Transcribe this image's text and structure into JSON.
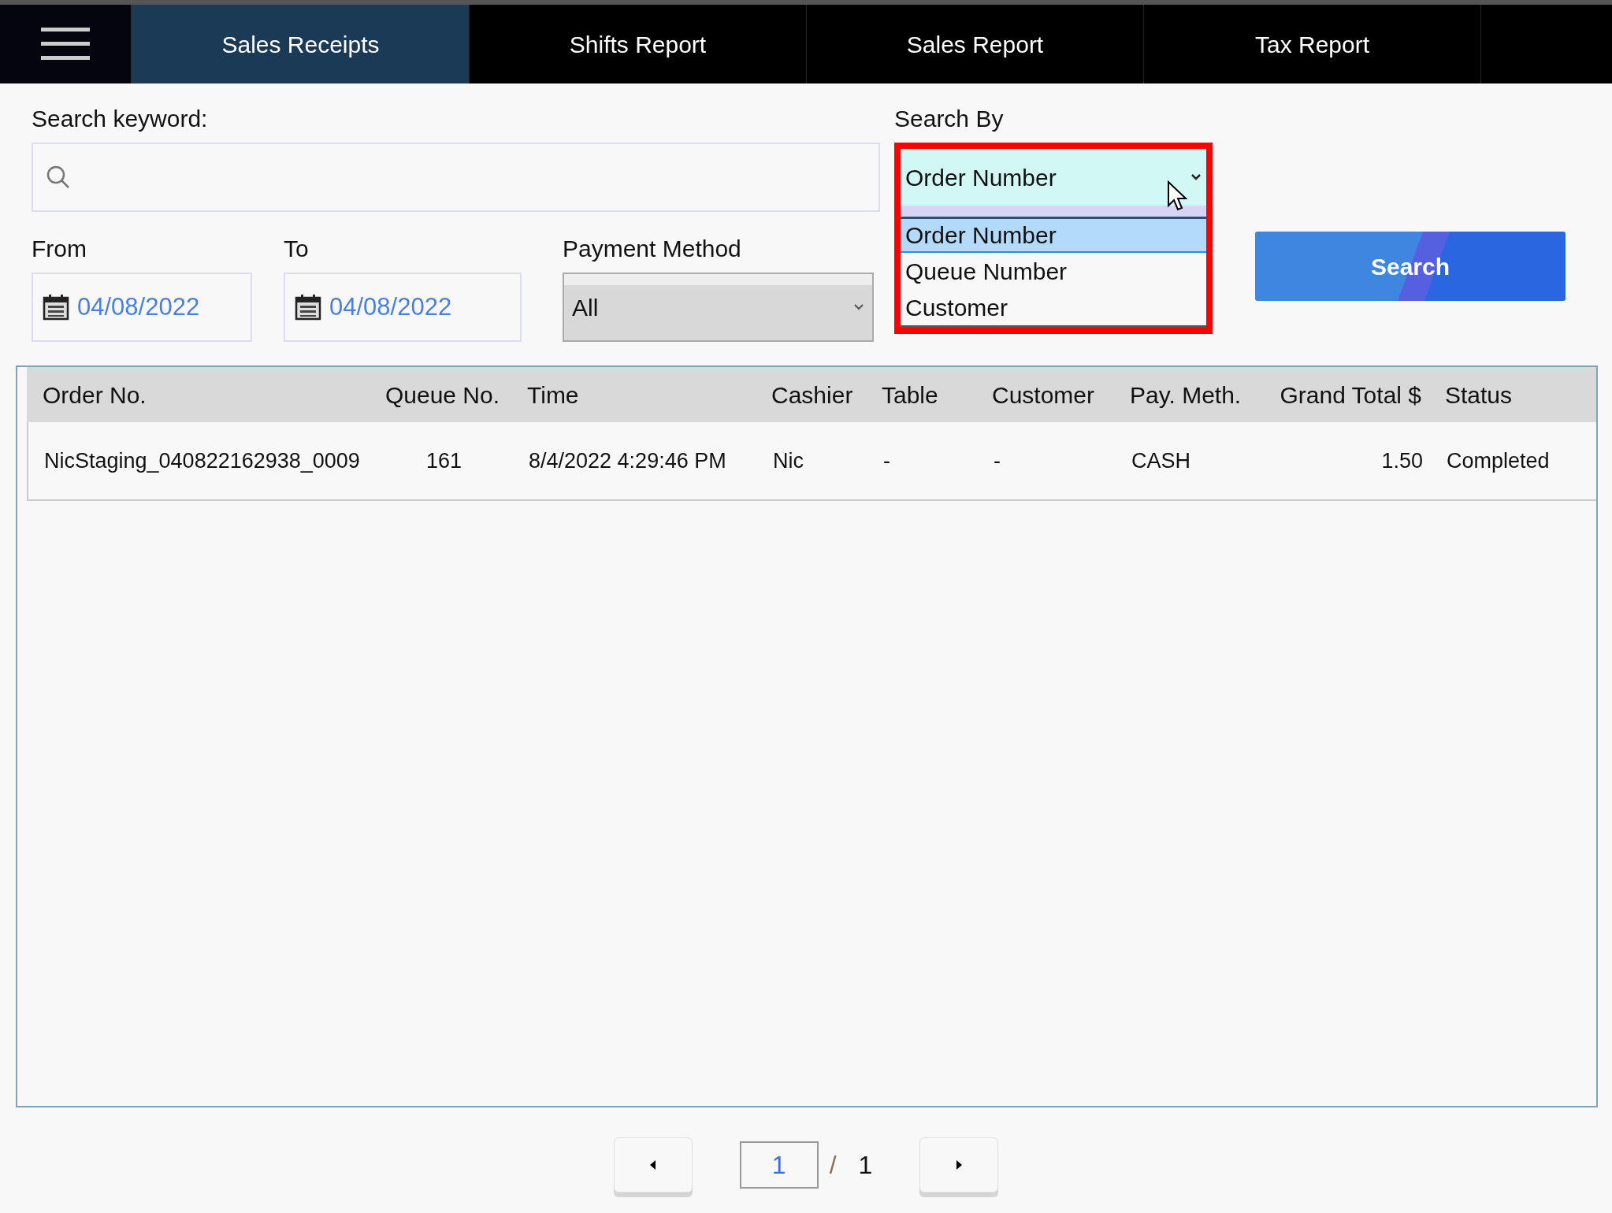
{
  "nav": {
    "tabs": [
      {
        "label": "Sales Receipts",
        "selected": true
      },
      {
        "label": "Shifts Report",
        "selected": false
      },
      {
        "label": "Sales Report",
        "selected": false
      },
      {
        "label": "Tax Report",
        "selected": false
      }
    ]
  },
  "filters": {
    "keyword": {
      "label": "Search keyword:"
    },
    "from": {
      "label": "From",
      "value": "04/08/2022"
    },
    "to": {
      "label": "To",
      "value": "04/08/2022"
    },
    "payment_method": {
      "label": "Payment Method",
      "value": "All"
    },
    "search_by": {
      "label": "Search By",
      "value": "Order Number",
      "expanded": true,
      "options": [
        {
          "label": "Order Number",
          "selected": true
        },
        {
          "label": "Queue Number",
          "selected": false
        },
        {
          "label": "Customer",
          "selected": false
        }
      ]
    },
    "search_button": "Search"
  },
  "table": {
    "columns": [
      "Order No.",
      "Queue No.",
      "Time",
      "Cashier",
      "Table",
      "Customer",
      "Pay. Meth.",
      "Grand Total $",
      "Status"
    ],
    "rows": [
      [
        "NicStaging_040822162938_0009",
        "161",
        "8/4/2022 4:29:46 PM",
        "Nic",
        "-",
        "-",
        "CASH",
        "1.50",
        "Completed"
      ]
    ]
  },
  "pagination": {
    "page": "1",
    "separator": "/",
    "total": "1"
  }
}
